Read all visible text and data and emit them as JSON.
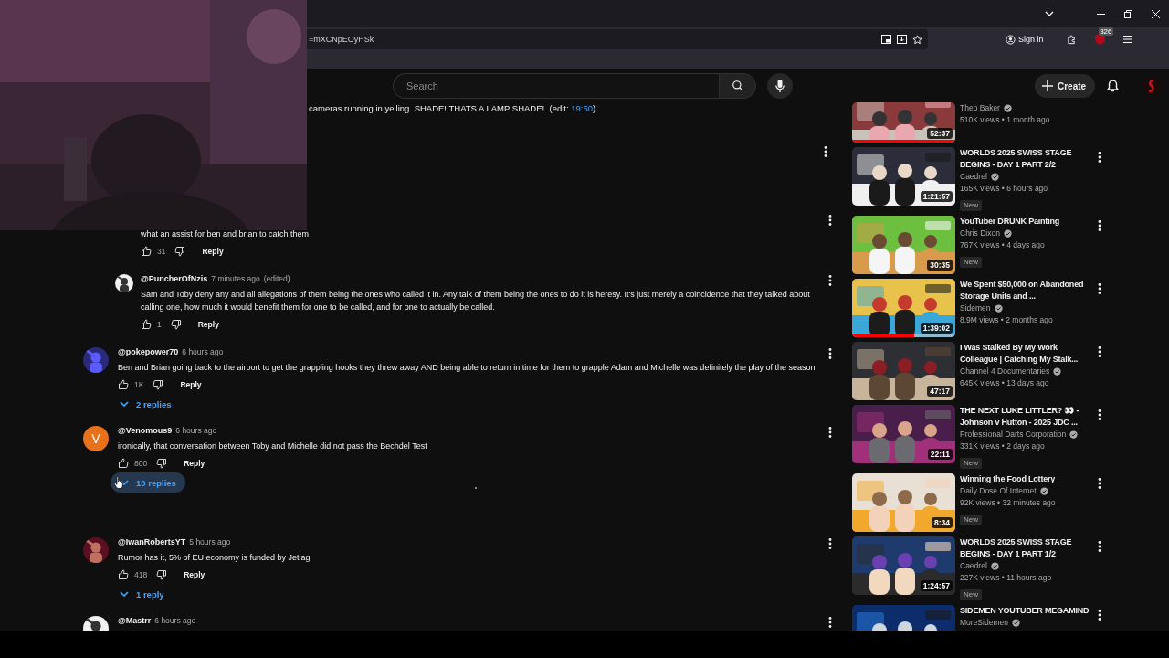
{
  "browser": {
    "url": "=mXCNpEOyHSk",
    "sign_in": "Sign in",
    "extension_badge": "326"
  },
  "masthead": {
    "search_placeholder": "Search",
    "create": "Create"
  },
  "comments": [
    {
      "kind": "fragment",
      "text": "cameras running in yelling  SHADE! THATS A LAMP SHADE!  (edit: ",
      "link": "19:50",
      "text_after": ")"
    },
    {
      "kind": "menu_only"
    },
    {
      "kind": "reply",
      "text": "what an assist for ben and brian to catch them",
      "likes": "31",
      "reply_label": "Reply"
    },
    {
      "kind": "reply",
      "author": "@PuncherOfNzis",
      "time": "7 minutes ago",
      "edited": "(edited)",
      "text": "Sam and Toby deny any and all allegations of them being the ones who called it in. Any talk of them being the ones to do it is heresy. It's just merely a coincidence that they talked about calling one, how much it would benefit them for one to be called, and for one to actually be called.",
      "likes": "1",
      "reply_label": "Reply"
    },
    {
      "kind": "comment",
      "author": "@pokepower70",
      "time": "6 hours ago",
      "text": "Ben and Brian going back to the airport to get the grappling hooks they threw away AND being able to return in time for them to grapple Adam and Michelle was definitely the play of the season",
      "likes": "1K",
      "reply_label": "Reply",
      "replies": {
        "label": "2 replies",
        "hovered": false,
        "loading": false
      }
    },
    {
      "kind": "comment",
      "avatar": {
        "kind": "letter",
        "letter": "V",
        "color": "#e8711c"
      },
      "author": "@Venomous9",
      "time": "6 hours ago",
      "text": "ironically, that conversation between Toby and Michelle did not pass the Bechdel Test",
      "likes": "800",
      "reply_label": "Reply",
      "replies": {
        "label": "10 replies",
        "hovered": true,
        "loading": true
      }
    },
    {
      "kind": "comment",
      "author": "@IwanRobertsYT",
      "time": "5 hours ago",
      "text": "Rumor has it, 5% of EU economy is funded by Jetlag",
      "likes": "418",
      "reply_label": "Reply",
      "replies": {
        "label": "1 reply",
        "hovered": false,
        "loading": false
      }
    },
    {
      "kind": "comment",
      "author": "@Mastrr",
      "time": "6 hours ago"
    }
  ],
  "videos": [
    {
      "channel": "Theo Baker",
      "verified": true,
      "meta": "510K views • 1 month ago",
      "duration": "52:37",
      "level": 1
    },
    {
      "title": "WORLDS 2025 SWISS STAGE BEGINS - DAY 1 PART 2/2",
      "channel": "Caedrel",
      "verified": true,
      "meta": "165K views • 6 hours ago",
      "badge": "New",
      "duration": "1:21:57"
    },
    {
      "title": "YouTuber DRUNK Painting",
      "channel": "Chris Dixon",
      "verified": true,
      "meta": "767K views • 4 days ago",
      "badge": "New",
      "duration": "30:35"
    },
    {
      "title": "We Spent $50,000 on Abandoned Storage Units and ...",
      "channel": "Sidemen",
      "verified": true,
      "meta": "8.9M views • 2 months ago",
      "duration": "1:39:02",
      "level": 0.6
    },
    {
      "title": "I Was Stalked By My Work Colleague | Catching My Stalk...",
      "channel": "Channel 4 Documentaries",
      "verified": true,
      "meta": "645K views • 13 days ago",
      "duration": "47:17"
    },
    {
      "title": "THE NEXT LUKE LITTLER? 👀 - Johnson v Hutton - 2025 JDC ...",
      "channel": "Professional Darts Corporation",
      "verified": true,
      "meta": "331K views • 2 days ago",
      "badge": "New",
      "duration": "22:11"
    },
    {
      "title": "Winning the Food Lottery",
      "channel": "Daily Dose Of Internet",
      "verified": true,
      "meta": "92K views • 32 minutes ago",
      "badge": "New",
      "duration": "8:34"
    },
    {
      "title": "WORLDS 2025 SWISS STAGE BEGINS - DAY 1 PART 1/2",
      "channel": "Caedrel",
      "verified": true,
      "meta": "227K views • 11 hours ago",
      "badge": "New",
      "duration": "1:24:57"
    },
    {
      "title": "SIDEMEN YOUTUBER MEGAMIND",
      "channel": "MoreSidemen",
      "verified": true
    }
  ]
}
